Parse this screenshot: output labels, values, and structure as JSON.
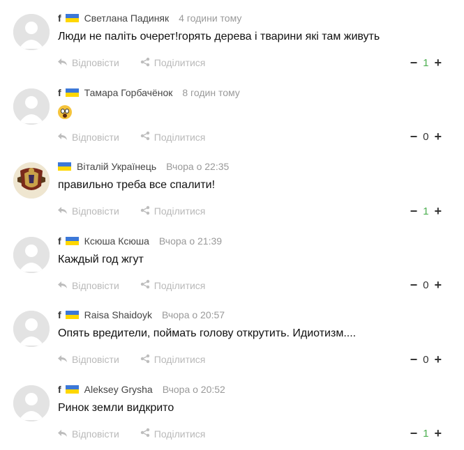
{
  "actions": {
    "reply_label": "Відповісти",
    "share_label": "Поділитися"
  },
  "vote_controls": {
    "minus": "−",
    "plus": "+"
  },
  "facebook_glyph": "f",
  "colors": {
    "flag_blue": "#3c78d8",
    "flag_yellow": "#ffd700",
    "positive_count": "#4caf50",
    "muted": "#b9b9b9"
  },
  "comments": [
    {
      "author": "Светлана Падиняк",
      "time": "4 години тому",
      "text": "Люди не паліть очерет!горять дерева і тварини які там живуть",
      "score": "1",
      "avatar": "placeholder",
      "facebook": true
    },
    {
      "author": "Тамара Горбачёнок",
      "time": "8 годин тому",
      "text": "",
      "emoji": "astonished-face-emoji",
      "score": "0",
      "avatar": "placeholder",
      "facebook": true
    },
    {
      "author": "Віталій Українець",
      "time": "Вчора о 22:35",
      "text": "правильно треба все спалити!",
      "score": "1",
      "avatar": "coat-of-arms",
      "facebook": false
    },
    {
      "author": "Ксюша Ксюша",
      "time": "Вчора о 21:39",
      "text": "Каждый год жгут",
      "score": "0",
      "avatar": "placeholder",
      "facebook": true
    },
    {
      "author": "Raisa Shaidoyk",
      "time": "Вчора о 20:57",
      "text": "Опять вредители, поймать голову открутить. Идиотизм....",
      "score": "0",
      "avatar": "placeholder",
      "facebook": true
    },
    {
      "author": "Aleksey Grysha",
      "time": "Вчора о 20:52",
      "text": "Ринок земли видкрито",
      "score": "1",
      "avatar": "placeholder",
      "facebook": true
    }
  ]
}
